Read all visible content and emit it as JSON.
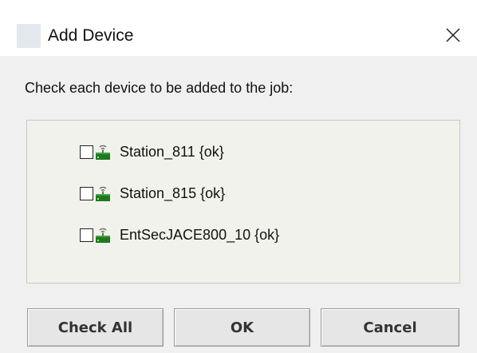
{
  "window": {
    "title": "Add Device",
    "app_icon": "app-icon",
    "close_icon": "close-icon"
  },
  "dialog": {
    "instruction": "Check each device to be added to the job:",
    "devices": [
      {
        "label": "Station_811 {ok}",
        "checked": false,
        "icon": "station-icon"
      },
      {
        "label": "Station_815 {ok}",
        "checked": false,
        "icon": "station-icon"
      },
      {
        "label": "EntSecJACE800_10 {ok}",
        "checked": false,
        "icon": "station-icon"
      }
    ]
  },
  "buttons": {
    "check_all": "Check All",
    "ok": "OK",
    "cancel": "Cancel"
  },
  "colors": {
    "dialog_bg": "#f0f0f0",
    "panel_bg": "#f2f2ec",
    "station_icon_green": "#1f7a1f",
    "button_bg": "#e6e6e6"
  }
}
